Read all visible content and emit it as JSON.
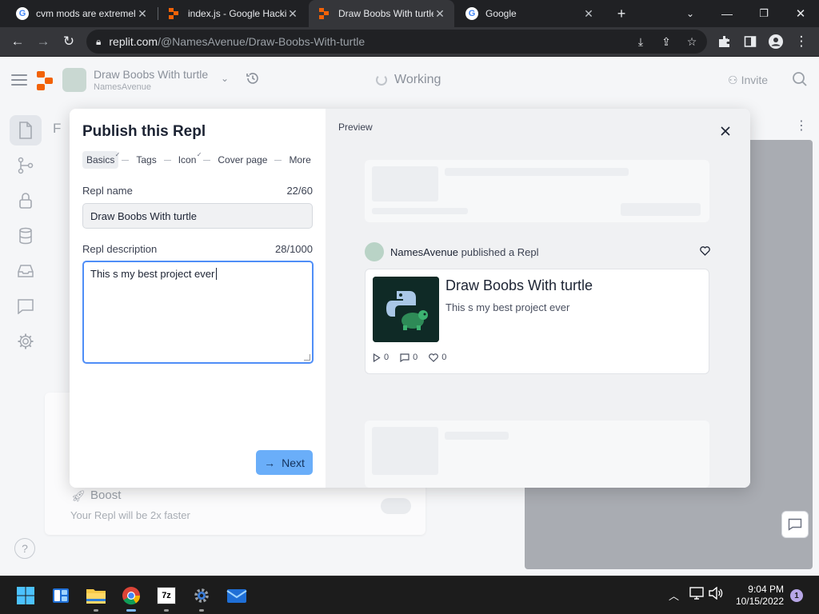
{
  "browser": {
    "tabs": [
      {
        "title": "cvm mods are extremel",
        "favicon": "google-icon"
      },
      {
        "title": "index.js - Google Hackin",
        "favicon": "replit-icon"
      },
      {
        "title": "Draw Boobs With turtle",
        "favicon": "replit-icon",
        "active": true
      },
      {
        "title": "Google",
        "favicon": "google-icon"
      }
    ],
    "url_domain": "replit.com",
    "url_path": "/@NamesAvenue/Draw-Boobs-With-turtle"
  },
  "replit_header": {
    "repl_title": "Draw Boobs With turtle",
    "repl_owner": "NamesAvenue",
    "status": "Working",
    "invite_label": "Invite"
  },
  "background": {
    "boost_title": "Boost",
    "boost_desc": "Your Repl will be 2x faster",
    "partial_letter": "F"
  },
  "publish_modal": {
    "title": "Publish this Repl",
    "steps": [
      {
        "label": "Basics",
        "checked": true,
        "current": true
      },
      {
        "label": "Tags",
        "checked": false
      },
      {
        "label": "Icon",
        "checked": true
      },
      {
        "label": "Cover page",
        "checked": false
      },
      {
        "label": "More",
        "checked": false
      }
    ],
    "name_label": "Repl name",
    "name_count": "22/60",
    "name_value": "Draw Boobs With turtle",
    "desc_label": "Repl description",
    "desc_count": "28/1000",
    "desc_value": "This s my best project ever",
    "next_label": "Next",
    "preview_label": "Preview",
    "preview": {
      "publisher": "NamesAvenue",
      "published_text": "published a Repl",
      "card_title": "Draw Boobs With turtle",
      "card_desc": "This s my best project ever",
      "runs": "0",
      "comments": "0",
      "likes": "0"
    }
  },
  "taskbar": {
    "time": "9:04 PM",
    "date": "10/15/2022",
    "notification_count": "1"
  },
  "colors": {
    "accent_blue": "#4f8ef7",
    "next_button": "#6aaef9",
    "replit_orange": "#f26207"
  }
}
